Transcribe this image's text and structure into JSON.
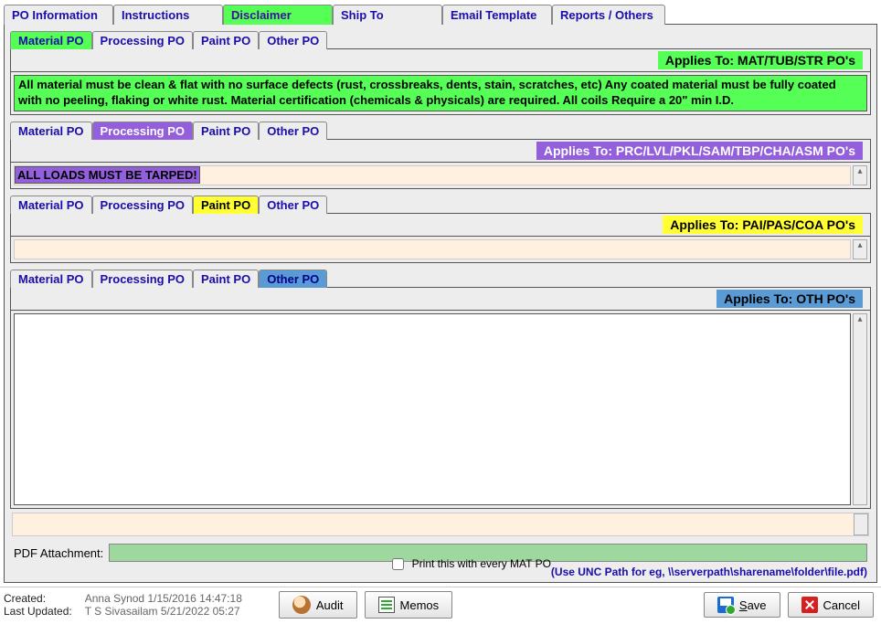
{
  "topTabs": {
    "t0": "PO Information",
    "t1": "Instructions",
    "t2": "Disclaimer",
    "t3": "Ship To",
    "t4": "Email Template",
    "t5": "Reports / Others"
  },
  "subTabs": {
    "material": "Material PO",
    "processing": "Processing PO",
    "paint": "Paint PO",
    "other": "Other PO"
  },
  "applies": {
    "material": "Applies To: MAT/TUB/STR PO's",
    "processing": "Applies To: PRC/LVL/PKL/SAM/TBP/CHA/ASM PO's",
    "paint": "Applies To: PAI/PAS/COA PO's",
    "other": "Applies To: OTH PO's"
  },
  "disclaimers": {
    "material": "All material must be clean & flat with no surface defects (rust, crossbreaks, dents, stain, scratches, etc) Any coated material must be fully coated with no peeling, flaking or white rust.  Material certification (chemicals & physicals) are required.  All coils Require a 20\" min I.D.",
    "processing": "ALL LOADS MUST BE TARPED!"
  },
  "pdf": {
    "label": "PDF Attachment:",
    "value": "",
    "hint": "(Use UNC Path for eg, \\\\serverpath\\sharename\\folder\\file.pdf)",
    "checkbox_label": "Print this with every MAT PO"
  },
  "meta": {
    "created_label": "Created:",
    "created_value": "Anna Synod 1/15/2016 14:47:18",
    "updated_label": "Last Updated:",
    "updated_value": "T S Sivasailam 5/21/2022 05:27"
  },
  "buttons": {
    "audit": "Audit",
    "memos": "Memos",
    "save": "Save",
    "cancel": "Cancel"
  }
}
